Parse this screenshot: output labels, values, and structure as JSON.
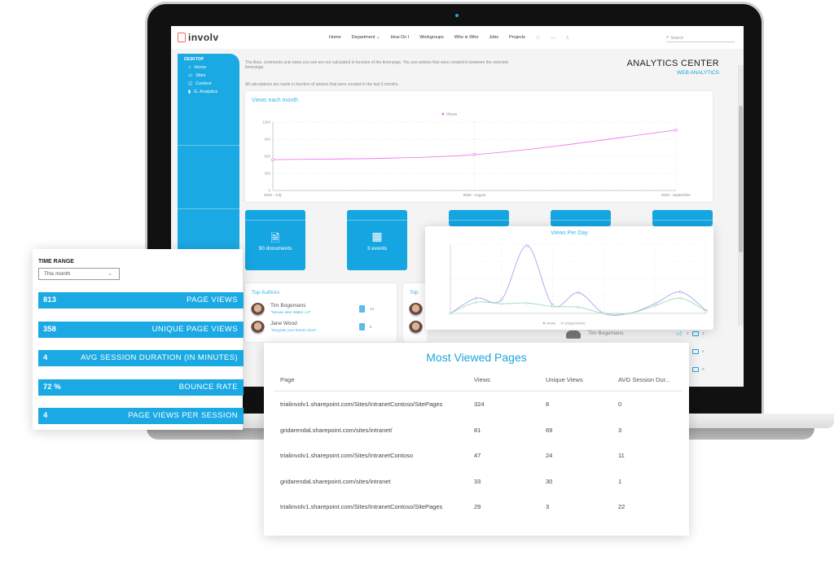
{
  "app": {
    "logo_text": "involv",
    "nav": [
      "Home",
      "Department",
      "How Do I",
      "Workgroups",
      "Who is Who",
      "Jobs",
      "Projects"
    ],
    "nav_icons": [
      "people-icon",
      "video-icon",
      "network-icon"
    ],
    "search_placeholder": "Search"
  },
  "sidebar": {
    "heading": "DESKTOP",
    "items": [
      {
        "label": "Home",
        "icon": "home-icon"
      },
      {
        "label": "Sites",
        "icon": "sites-icon"
      },
      {
        "label": "Content",
        "icon": "content-icon"
      },
      {
        "label": "G. Analytics",
        "icon": "bar-chart-icon"
      }
    ]
  },
  "header": {
    "info_line1": "The likes, comments and views you see are not calculated in function of the timerange. You see articles that were created in between the selected timerange.",
    "info_line2": "All calculations are made in function of articles that were created in the last 6 months.",
    "title": "ANALYTICS CENTER",
    "subtitle": "WEB ANALYTICS"
  },
  "tiles": [
    {
      "label": "90 documents",
      "icon": "document-icon"
    },
    {
      "label": "3 events",
      "icon": "calendar-icon"
    },
    {
      "label": "",
      "icon": ""
    },
    {
      "label": "",
      "icon": ""
    },
    {
      "label": "",
      "icon": ""
    }
  ],
  "top_authors": {
    "title": "Top Authors",
    "authors": [
      {
        "name": "Tim Bogemans",
        "article": "\"Nieuwe idee Walter 1.0\"",
        "count": "14"
      },
      {
        "name": "Jane Wood",
        "article": "\"Integrate your brand colors\"",
        "count": "6"
      }
    ]
  },
  "top_second": {
    "title": "Top"
  },
  "comments": {
    "name": "Tim Bogemans",
    "likes": "3",
    "comment_counts": [
      "3",
      "2",
      "0"
    ]
  },
  "kpi": {
    "time_range_label": "TIME RANGE",
    "time_range_value": "This month",
    "items": [
      {
        "value": "813",
        "label": "PAGE VIEWS"
      },
      {
        "value": "358",
        "label": "UNIQUE PAGE VIEWS"
      },
      {
        "value": "4",
        "label": "AVG SESSION DURATION (IN MINUTES)"
      },
      {
        "value": "72 %",
        "label": "BOUNCE RATE"
      },
      {
        "value": "4",
        "label": "PAGE VIEWS PER SESSION"
      }
    ]
  },
  "most_viewed": {
    "title": "Most Viewed Pages",
    "columns": [
      "Page",
      "Views",
      "Unique Views",
      "AVG Session Dur..."
    ],
    "rows": [
      [
        "trialinvolv1.sharepoint.com/Sites/IntranetContoso/SitePages",
        "324",
        "8",
        "0"
      ],
      [
        "gridarendal.sharepoint.com/sites/intranet/",
        "81",
        "69",
        "3"
      ],
      [
        "trialinvolv1.sharepoint.com/Sites/IntranetContoso",
        "47",
        "24",
        "11"
      ],
      [
        "gridarendal.sharepoint.com/sites/intranet",
        "33",
        "30",
        "1"
      ],
      [
        "trialinvolv1.sharepoint.com/Sites/IntranetContoso/SitePages",
        "29",
        "3",
        "22"
      ]
    ]
  },
  "chart_data": [
    {
      "type": "line",
      "title": "Views each month",
      "categories": [
        "2020 - July",
        "2020 - August",
        "2020 - September"
      ],
      "series": [
        {
          "name": "Views",
          "values": [
            540,
            630,
            1060
          ],
          "color": "#f07cf0"
        }
      ],
      "yticks": [
        "0",
        "300",
        "600",
        "900",
        "1200"
      ],
      "ylim": [
        0,
        1200
      ],
      "legend": "top-center",
      "grid": true
    },
    {
      "type": "line",
      "title": "Views Per Day",
      "x": [
        0,
        1,
        2,
        3,
        4,
        5,
        6,
        7,
        8,
        9,
        10
      ],
      "series": [
        {
          "name": "views",
          "values": [
            0,
            22,
            20,
            98,
            12,
            30,
            0,
            0,
            14,
            31,
            4
          ],
          "color": "#a9a4ee"
        },
        {
          "name": "uniqueViews",
          "values": [
            0,
            16,
            14,
            15,
            10,
            9,
            0,
            0,
            11,
            22,
            3
          ],
          "color": "#9ee0b4"
        }
      ],
      "ylim": [
        0,
        100
      ],
      "legend": "bottom-center",
      "grid": true
    }
  ]
}
